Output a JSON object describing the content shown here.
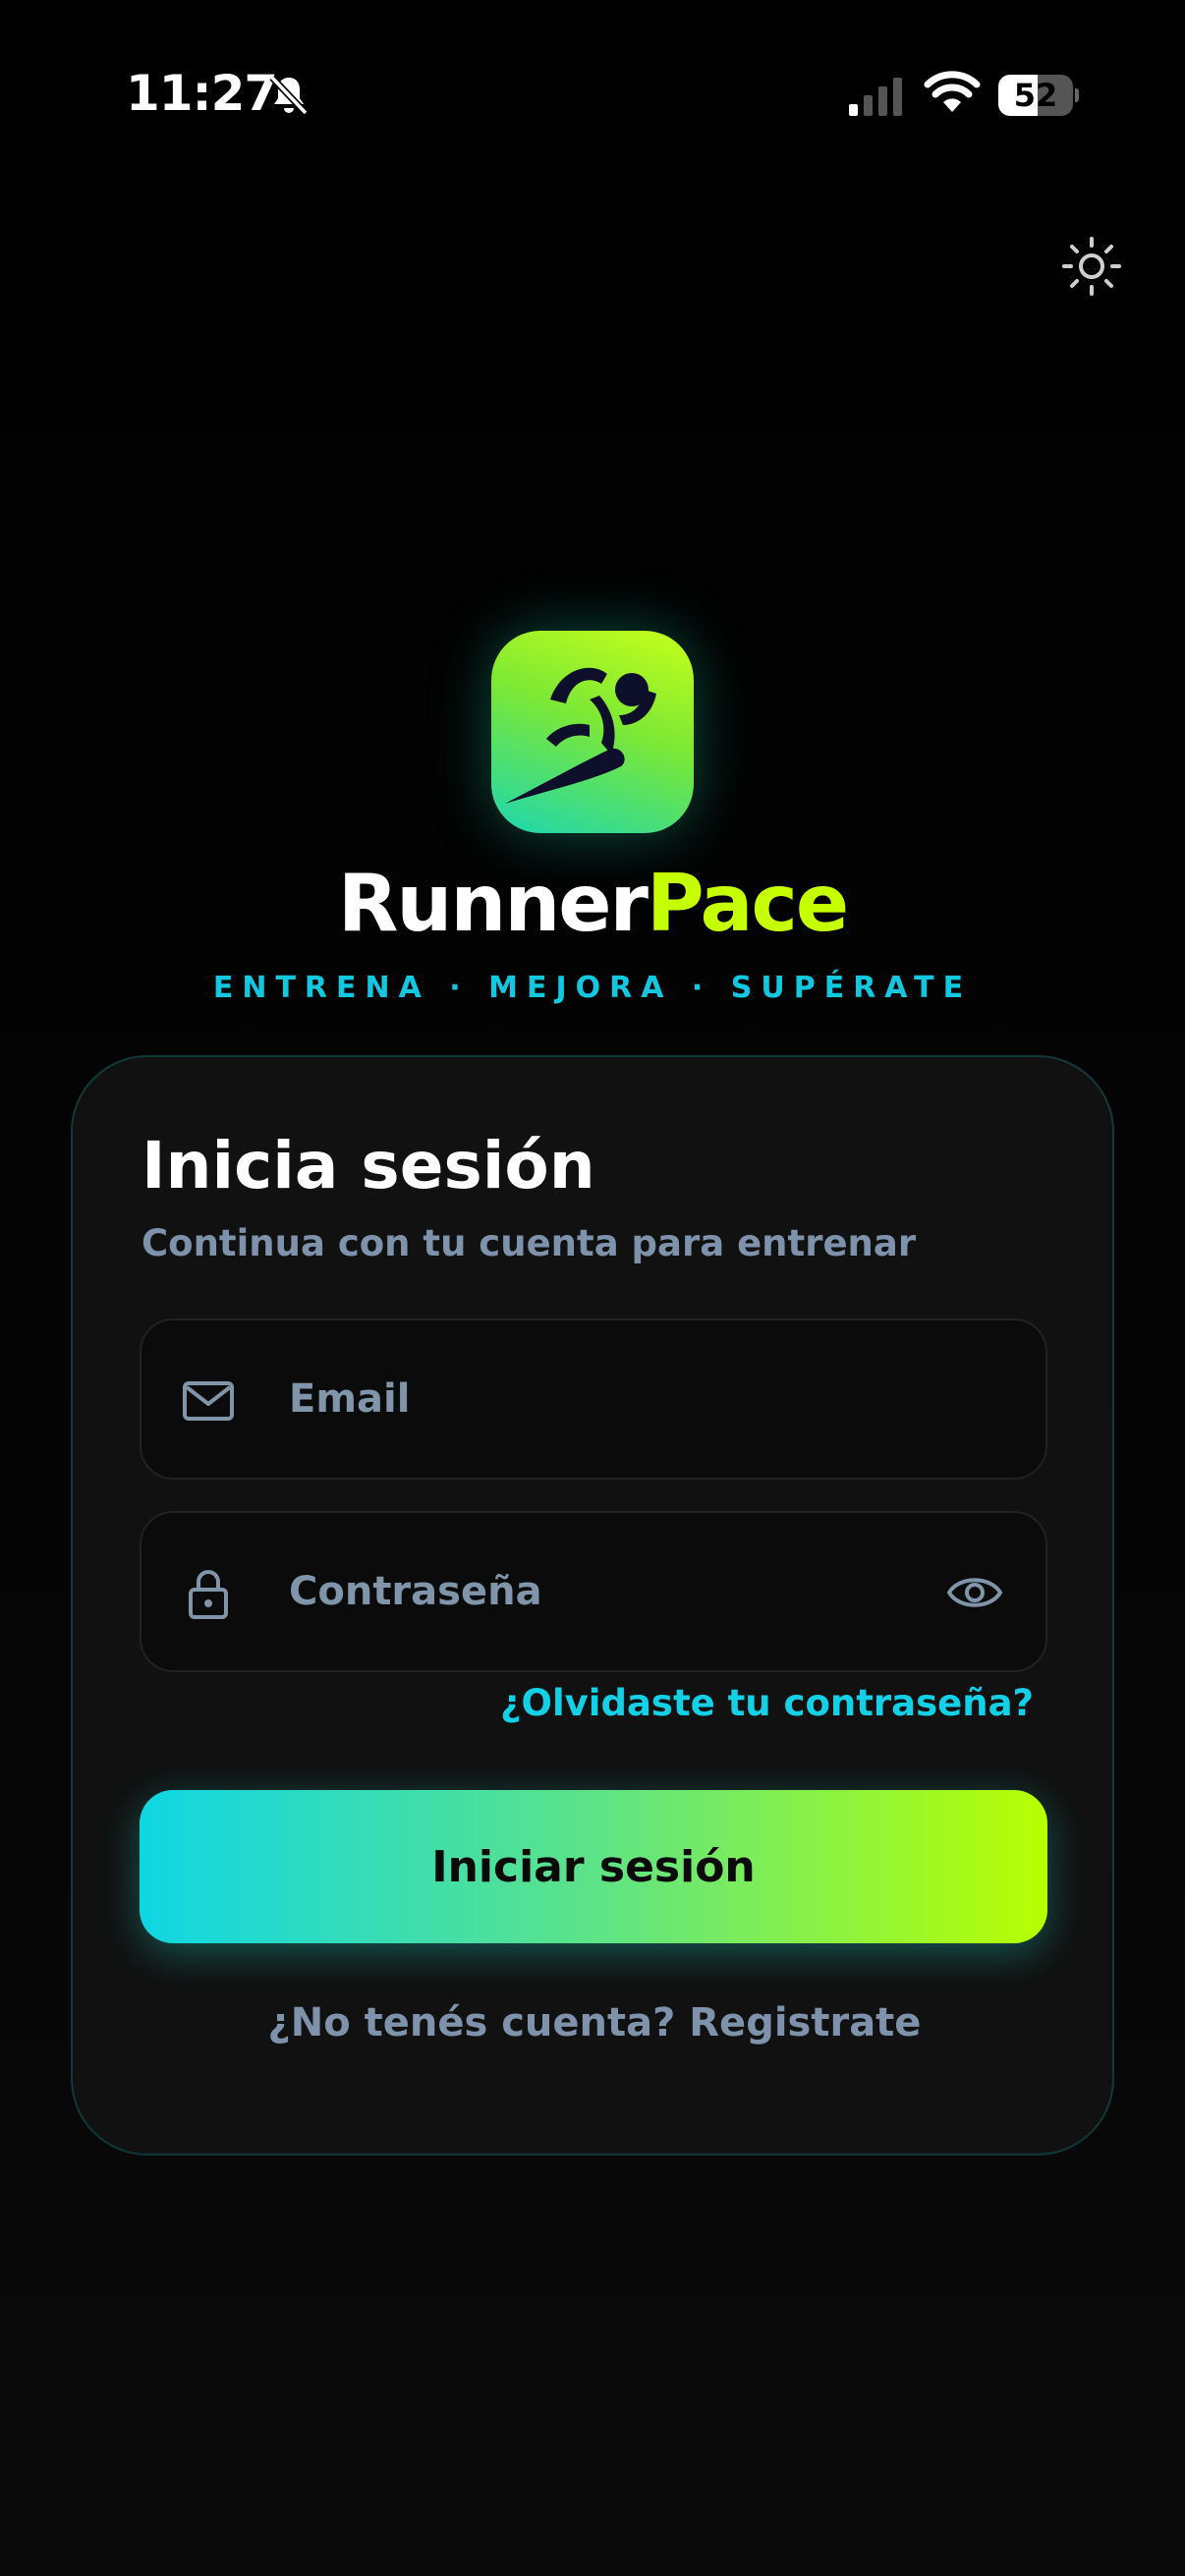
{
  "status_bar": {
    "time": "11:27",
    "battery": "52",
    "battery_level": 0.52
  },
  "brand": {
    "name_part1": "Runner",
    "name_part2": "Pace",
    "tagline": "ENTRENA · MEJORA · SUPÉRATE",
    "color_primary": "#c6ff00",
    "color_accent": "#12c8e0"
  },
  "login": {
    "title": "Inicia sesión",
    "subtitle": "Continua con tu cuenta para entrenar",
    "email_placeholder": "Email",
    "email_value": "",
    "password_placeholder": "Contraseña",
    "password_value": "",
    "forgot_label": "¿Olvidaste tu contraseña?",
    "submit_label": "Iniciar sesión",
    "register_label": "¿No tenés cuenta? Registrate"
  },
  "icons": {
    "theme": "sun-icon",
    "email": "mail-icon",
    "password": "lock-icon",
    "show_password": "eye-icon",
    "logo": "runner-icon"
  }
}
